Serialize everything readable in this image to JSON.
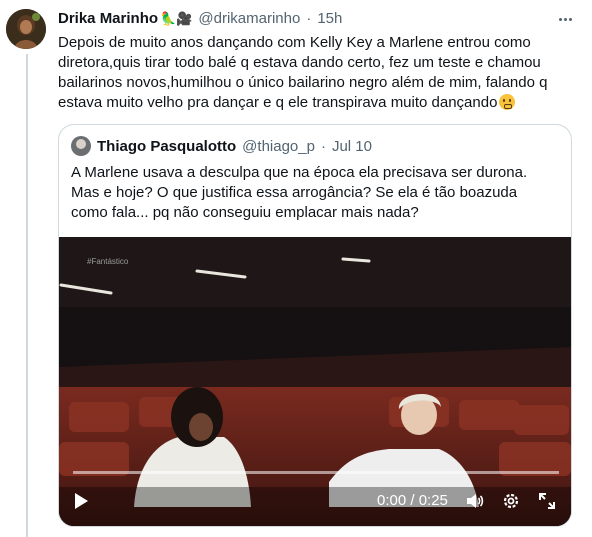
{
  "tweet": {
    "author_name": "Drika Marinho",
    "author_emojis": "🦜🎥",
    "handle": "@drikamarinho",
    "separator": "·",
    "time": "15h",
    "lines": [
      "Depois de muito anos dançando com  Kelly Key a Marlene entrou como",
      "diretora,quis tirar todo balé q estava dando certo, fez um teste e chamou",
      "bailarinos novos,humilhou o único bailarino negro além de mim, falando q",
      "estava muito velho pra dançar e q ele transpirava muito dançando"
    ]
  },
  "quote": {
    "author_name": "Thiago Pasqualotto",
    "handle": "@thiago_p",
    "separator": "·",
    "date": "Jul 10",
    "lines": [
      "A Marlene usava a desculpa que na época ela precisava ser durona.",
      "Mas e hoje? O que justifica essa arrogância? Se ela é tão boazuda",
      "como fala... pq não conseguiu emplacar mais nada?"
    ]
  },
  "video": {
    "watermark": "#Fantástico",
    "time_display": "0:00 / 0:25",
    "progress": 0
  },
  "colors": {
    "text": "#0f1419",
    "secondary": "#536471",
    "border": "#cfd9de"
  }
}
